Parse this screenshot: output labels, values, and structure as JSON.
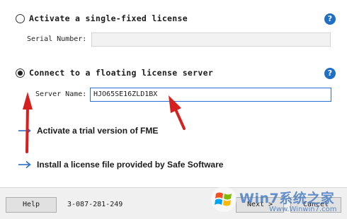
{
  "options": {
    "single_fixed": {
      "label": "Activate a single-fixed license",
      "checked": false,
      "serial_label": "Serial Number:",
      "serial_value": ""
    },
    "floating": {
      "label": "Connect to a floating license server",
      "checked": true,
      "server_label": "Server Name:",
      "server_value": "HJO65SE16ZLD1BX"
    }
  },
  "help_icon_glyph": "?",
  "links": {
    "trial": "Activate a trial version of FME",
    "license_file": "Install a license file provided by Safe Software"
  },
  "footer": {
    "help_label": "Help",
    "code": "3-087-281-249",
    "next_label": "Next >",
    "cancel_label": "Cancel"
  },
  "watermark": {
    "brand": "Win7系统之家",
    "url": "Www.Winwin7.com"
  },
  "colors": {
    "help_icon": "#1f6fc2",
    "link_arrow": "#2a6fc9",
    "annotation_arrow": "#d62020"
  }
}
